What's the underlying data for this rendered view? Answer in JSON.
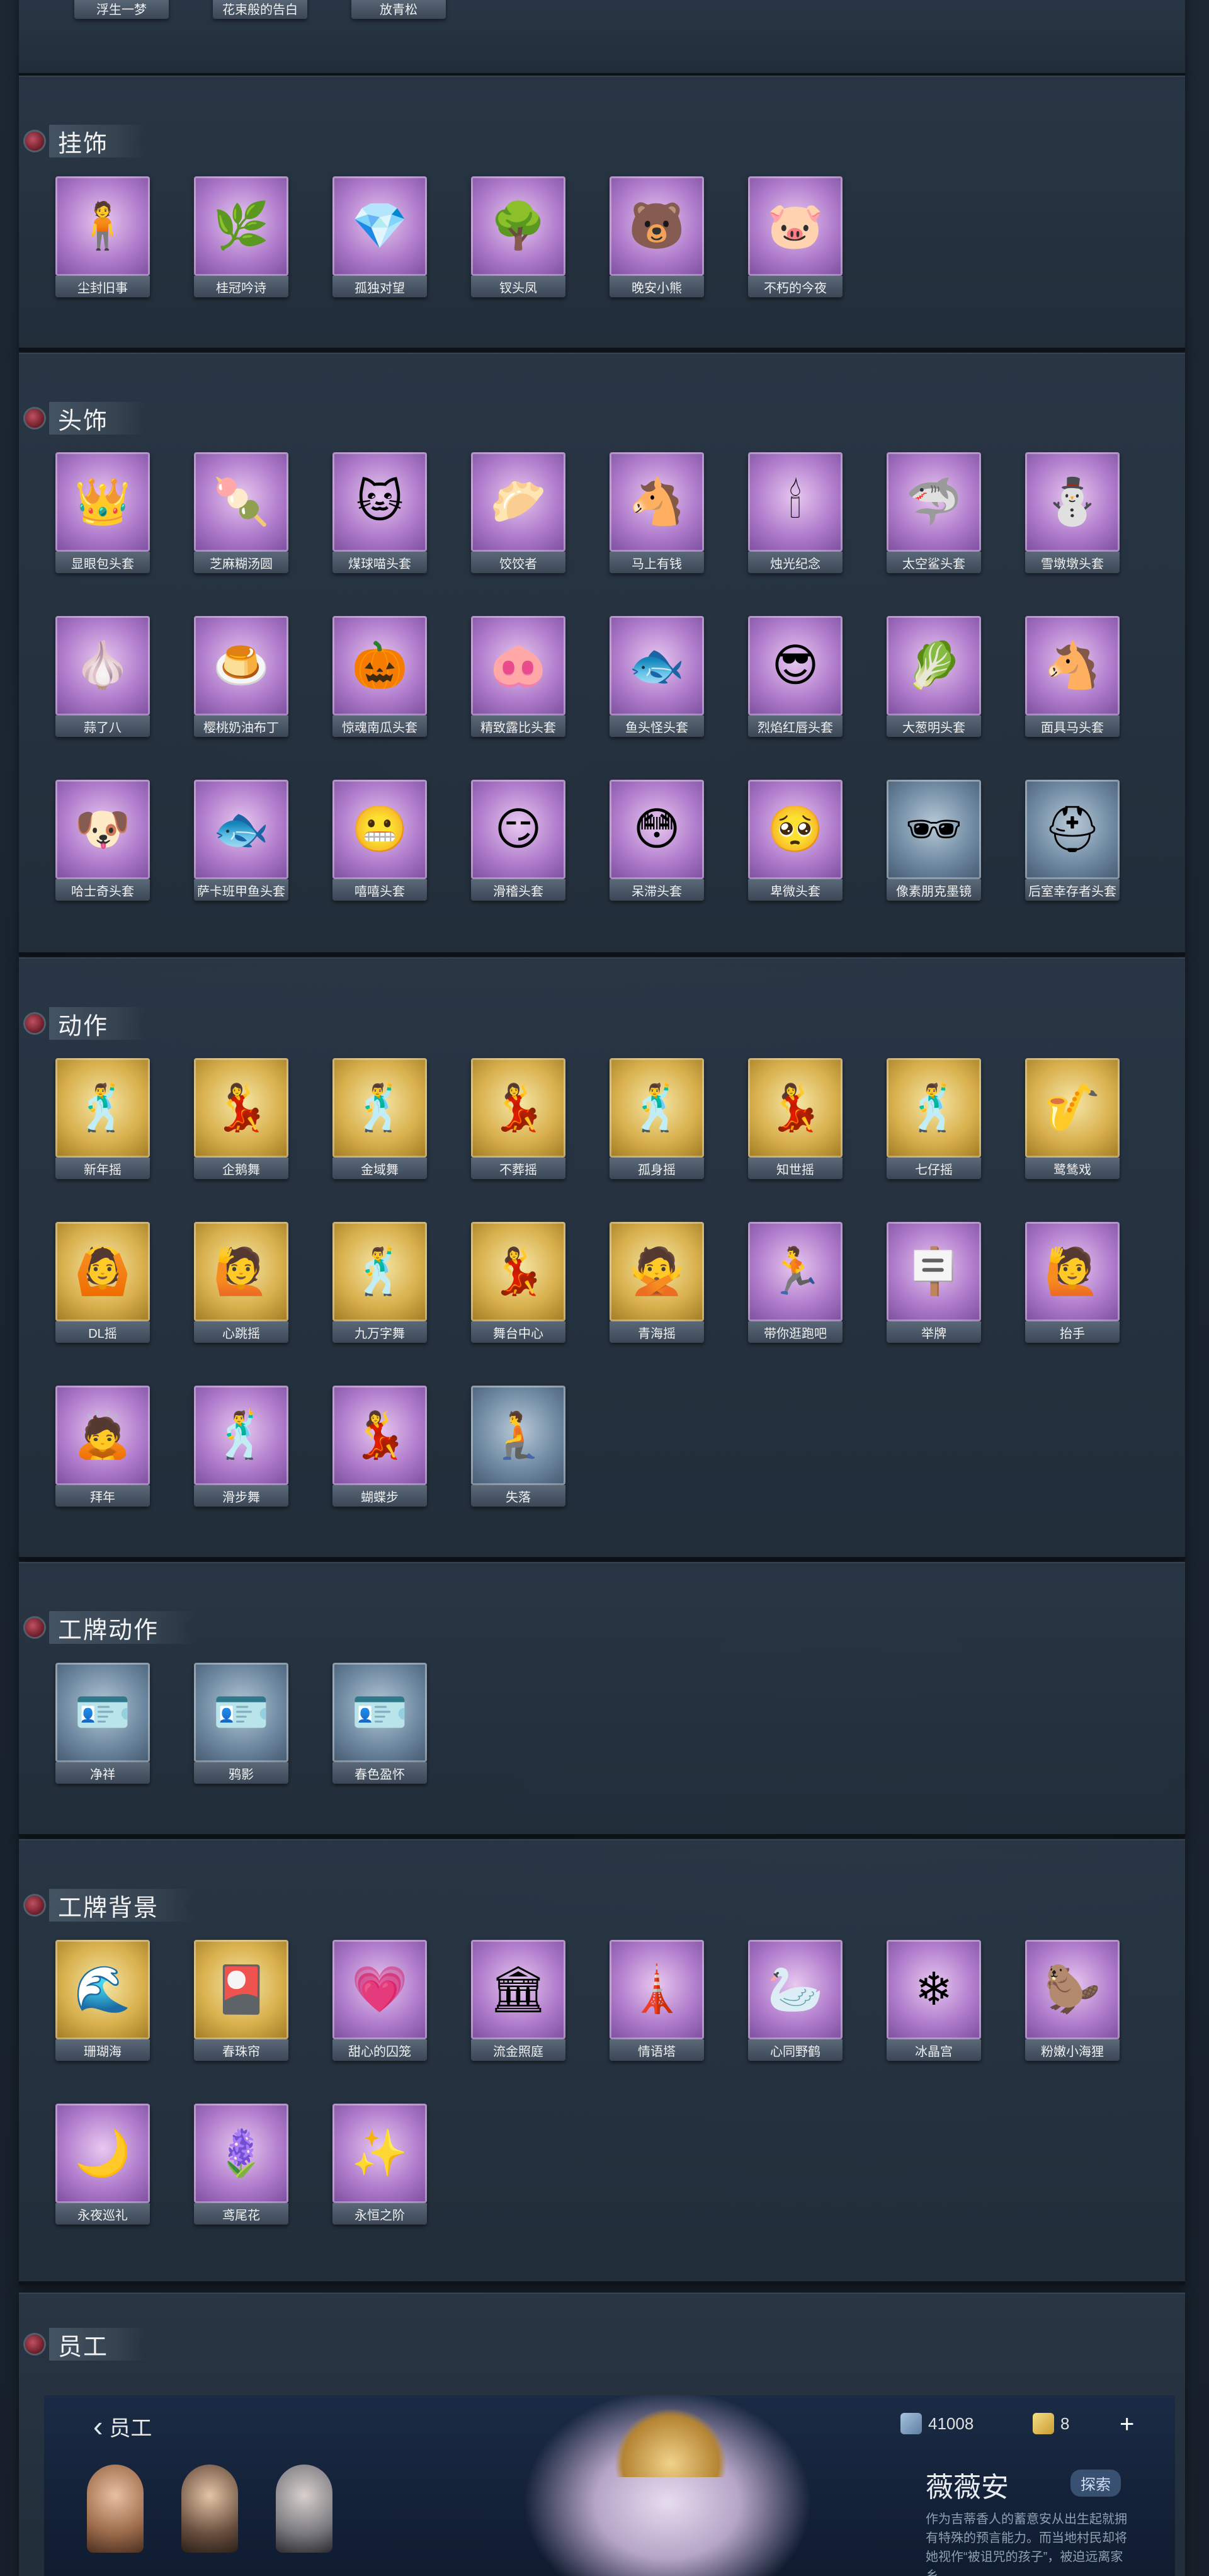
{
  "top_row": [
    "浮生一梦",
    "花束般的告白",
    "放青松"
  ],
  "sections": [
    {
      "id": "pendants",
      "title": "挂饰",
      "items": [
        {
          "label": "尘封旧事",
          "style": "purple",
          "icon": "🧍"
        },
        {
          "label": "桂冠吟诗",
          "style": "purple",
          "icon": "🌿"
        },
        {
          "label": "孤独对望",
          "style": "purple",
          "icon": "💎"
        },
        {
          "label": "钗头凤",
          "style": "purple",
          "icon": "🌳"
        },
        {
          "label": "晚安小熊",
          "style": "purple",
          "icon": "🐻"
        },
        {
          "label": "不朽的今夜",
          "style": "purple",
          "icon": "🐷"
        }
      ]
    },
    {
      "id": "headwear",
      "title": "头饰",
      "items": [
        {
          "label": "显眼包头套",
          "style": "purple",
          "icon": "👑"
        },
        {
          "label": "芝麻糊汤圆",
          "style": "purple",
          "icon": "🍡"
        },
        {
          "label": "煤球喵头套",
          "style": "purple",
          "icon": "🐱"
        },
        {
          "label": "饺饺者",
          "style": "purple",
          "icon": "🥟"
        },
        {
          "label": "马上有钱",
          "style": "purple",
          "icon": "🐴"
        },
        {
          "label": "烛光纪念",
          "style": "purple",
          "icon": "🕯"
        },
        {
          "label": "太空鲨头套",
          "style": "purple",
          "icon": "🦈"
        },
        {
          "label": "雪墩墩头套",
          "style": "purple",
          "icon": "⛄"
        },
        {
          "label": "蒜了八",
          "style": "purple",
          "icon": "🧄"
        },
        {
          "label": "樱桃奶油布丁",
          "style": "purple",
          "icon": "🍮"
        },
        {
          "label": "惊魂南瓜头套",
          "style": "purple",
          "icon": "🎃"
        },
        {
          "label": "精致露比头套",
          "style": "purple",
          "icon": "🐽"
        },
        {
          "label": "鱼头怪头套",
          "style": "purple",
          "icon": "🐟"
        },
        {
          "label": "烈焰红唇头套",
          "style": "purple",
          "icon": "😎"
        },
        {
          "label": "大葱明头套",
          "style": "purple",
          "icon": "🥬"
        },
        {
          "label": "面具马头套",
          "style": "purple",
          "icon": "🐴"
        },
        {
          "label": "哈士奇头套",
          "style": "purple",
          "icon": "🐶"
        },
        {
          "label": "萨卡班甲鱼头套",
          "style": "purple",
          "icon": "🐟"
        },
        {
          "label": "嘻嘻头套",
          "style": "purple",
          "icon": "😬"
        },
        {
          "label": "滑稽头套",
          "style": "purple",
          "icon": "😏"
        },
        {
          "label": "呆滞头套",
          "style": "purple",
          "icon": "😳"
        },
        {
          "label": "卑微头套",
          "style": "purple",
          "icon": "🥺"
        },
        {
          "label": "像素朋克墨镜",
          "style": "blue",
          "icon": "🕶"
        },
        {
          "label": "后室幸存者头套",
          "style": "blue",
          "icon": "⛑"
        }
      ]
    },
    {
      "id": "actions",
      "title": "动作",
      "items": [
        {
          "label": "新年摇",
          "style": "gold",
          "icon": "🕺"
        },
        {
          "label": "企鹅舞",
          "style": "gold",
          "icon": "💃"
        },
        {
          "label": "金域舞",
          "style": "gold",
          "icon": "🕺"
        },
        {
          "label": "不葬摇",
          "style": "gold",
          "icon": "💃"
        },
        {
          "label": "孤身摇",
          "style": "gold",
          "icon": "🕺"
        },
        {
          "label": "知世摇",
          "style": "gold",
          "icon": "💃"
        },
        {
          "label": "七仔摇",
          "style": "gold",
          "icon": "🕺"
        },
        {
          "label": "鹭鸶戏",
          "style": "gold",
          "icon": "🎷"
        },
        {
          "label": "DL摇",
          "style": "gold",
          "icon": "🙆"
        },
        {
          "label": "心跳摇",
          "style": "gold",
          "icon": "🙋"
        },
        {
          "label": "九万字舞",
          "style": "gold",
          "icon": "🕺"
        },
        {
          "label": "舞台中心",
          "style": "gold",
          "icon": "💃"
        },
        {
          "label": "青海摇",
          "style": "gold",
          "icon": "🙅"
        },
        {
          "label": "带你逛跑吧",
          "style": "purple",
          "icon": "🏃"
        },
        {
          "label": "举牌",
          "style": "purple",
          "icon": "🪧"
        },
        {
          "label": "抬手",
          "style": "purple",
          "icon": "🙋"
        },
        {
          "label": "拜年",
          "style": "purple",
          "icon": "🙇"
        },
        {
          "label": "滑步舞",
          "style": "purple",
          "icon": "🕺"
        },
        {
          "label": "蝴蝶步",
          "style": "purple",
          "icon": "💃"
        },
        {
          "label": "失落",
          "style": "blue",
          "icon": "🧎"
        }
      ]
    },
    {
      "id": "badge_actions",
      "title": "工牌动作",
      "items": [
        {
          "label": "净祥",
          "style": "blue",
          "icon": "🪪"
        },
        {
          "label": "鸦影",
          "style": "blue",
          "icon": "🪪"
        },
        {
          "label": "春色盈怀",
          "style": "blue",
          "icon": "🪪"
        }
      ]
    },
    {
      "id": "badge_backgrounds",
      "title": "工牌背景",
      "items": [
        {
          "label": "珊瑚海",
          "style": "gold",
          "icon": "🌊"
        },
        {
          "label": "春珠帘",
          "style": "gold",
          "icon": "🎴"
        },
        {
          "label": "甜心的囚笼",
          "style": "purple",
          "icon": "💗"
        },
        {
          "label": "流金照庭",
          "style": "purple",
          "icon": "🏛"
        },
        {
          "label": "情语塔",
          "style": "purple",
          "icon": "🗼"
        },
        {
          "label": "心同野鹤",
          "style": "purple",
          "icon": "🦢"
        },
        {
          "label": "冰晶宫",
          "style": "purple",
          "icon": "❄"
        },
        {
          "label": "粉嫩小海狸",
          "style": "purple",
          "icon": "🦫"
        },
        {
          "label": "永夜巡礼",
          "style": "purple",
          "icon": "🌙"
        },
        {
          "label": "鸢尾花",
          "style": "purple",
          "icon": "🪻"
        },
        {
          "label": "永恒之阶",
          "style": "purple",
          "icon": "✨"
        }
      ]
    }
  ],
  "staff": {
    "section_title": "员工",
    "back_label": "员工",
    "currency_1": "41008",
    "currency_2": "8",
    "character_name": "薇薇安",
    "explore_label": "探索",
    "bio": "作为吉蒂香人的蓄意安从出生起就拥有特殊的预言能力。而当地村民却将她视作“被诅咒的孩子”，被迫远离家乡……"
  }
}
